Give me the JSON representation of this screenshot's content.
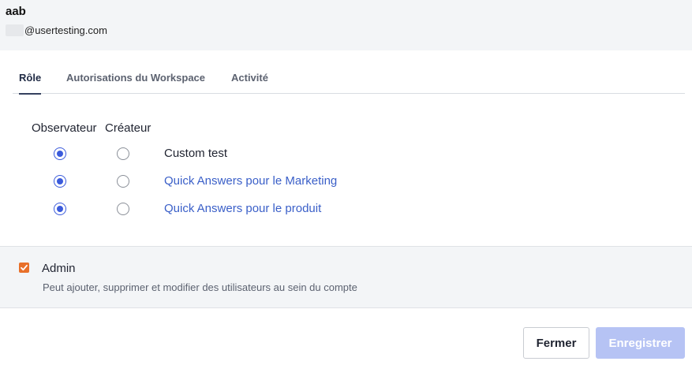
{
  "user": {
    "name": "aab",
    "email_suffix": "@usertesting.com"
  },
  "tabs": [
    {
      "label": "Rôle",
      "active": true
    },
    {
      "label": "Autorisations du Workspace",
      "active": false
    },
    {
      "label": "Activité",
      "active": false
    }
  ],
  "roles": {
    "columns": [
      "Observateur",
      "Créateur"
    ],
    "workspaces": [
      {
        "label": "Custom test",
        "selected_role": "Observateur",
        "style": "plain"
      },
      {
        "label": "Quick Answers pour le Marketing",
        "selected_role": "Observateur",
        "style": "link"
      },
      {
        "label": "Quick Answers pour le produit",
        "selected_role": "Observateur",
        "style": "link"
      }
    ]
  },
  "admin": {
    "checked": true,
    "label": "Admin",
    "description": "Peut ajouter, supprimer et modifier des utilisateurs au sein du compte"
  },
  "actions": {
    "close_label": "Fermer",
    "save_label": "Enregistrer",
    "save_enabled": false
  },
  "colors": {
    "accent": "#3b5bdb",
    "link": "#3a5fc8",
    "checkbox": "#e8702a",
    "save_disabled": "#b6c3f4"
  }
}
